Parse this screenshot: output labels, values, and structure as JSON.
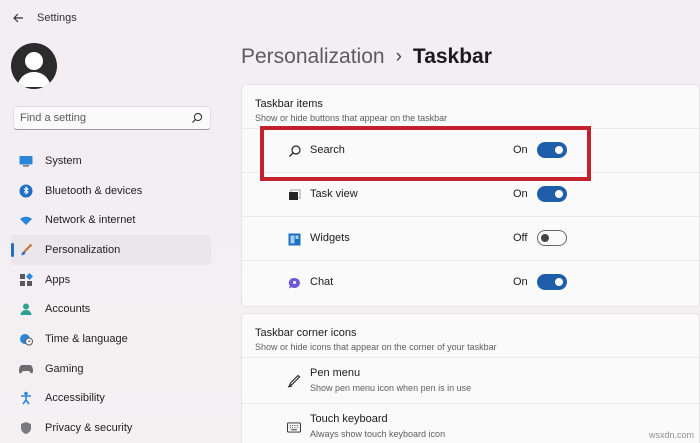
{
  "app": {
    "title": "Settings"
  },
  "search": {
    "placeholder": "Find a setting"
  },
  "sidebar": {
    "items": [
      {
        "label": "System",
        "icon": "monitor-icon",
        "active": false
      },
      {
        "label": "Bluetooth & devices",
        "icon": "bluetooth-icon",
        "active": false
      },
      {
        "label": "Network & internet",
        "icon": "wifi-icon",
        "active": false
      },
      {
        "label": "Personalization",
        "icon": "brush-icon",
        "active": true
      },
      {
        "label": "Apps",
        "icon": "apps-icon",
        "active": false
      },
      {
        "label": "Accounts",
        "icon": "person-icon",
        "active": false
      },
      {
        "label": "Time & language",
        "icon": "globe-clock-icon",
        "active": false
      },
      {
        "label": "Gaming",
        "icon": "gamepad-icon",
        "active": false
      },
      {
        "label": "Accessibility",
        "icon": "accessibility-icon",
        "active": false
      },
      {
        "label": "Privacy & security",
        "icon": "shield-icon",
        "active": false
      }
    ]
  },
  "breadcrumb": {
    "parent": "Personalization",
    "separator": "›",
    "current": "Taskbar"
  },
  "taskbar_items": {
    "title": "Taskbar items",
    "subtitle": "Show or hide buttons that appear on the taskbar",
    "rows": [
      {
        "label": "Search",
        "icon": "search-icon",
        "state": "On",
        "on": true
      },
      {
        "label": "Task view",
        "icon": "task-view-icon",
        "state": "On",
        "on": true
      },
      {
        "label": "Widgets",
        "icon": "widgets-icon",
        "state": "Off",
        "on": false
      },
      {
        "label": "Chat",
        "icon": "chat-icon",
        "state": "On",
        "on": true
      }
    ]
  },
  "corner_icons": {
    "title": "Taskbar corner icons",
    "subtitle": "Show or hide icons that appear on the corner of your taskbar",
    "rows": [
      {
        "label": "Pen menu",
        "desc": "Show pen menu icon when pen is in use",
        "icon": "pen-icon"
      },
      {
        "label": "Touch keyboard",
        "desc": "Always show touch keyboard icon",
        "icon": "keyboard-icon"
      }
    ]
  },
  "watermark": "wsxdn.com",
  "colors": {
    "accent": "#1f5ea8",
    "highlight": "#c4222b",
    "active_indicator": "#2a6cc0"
  }
}
